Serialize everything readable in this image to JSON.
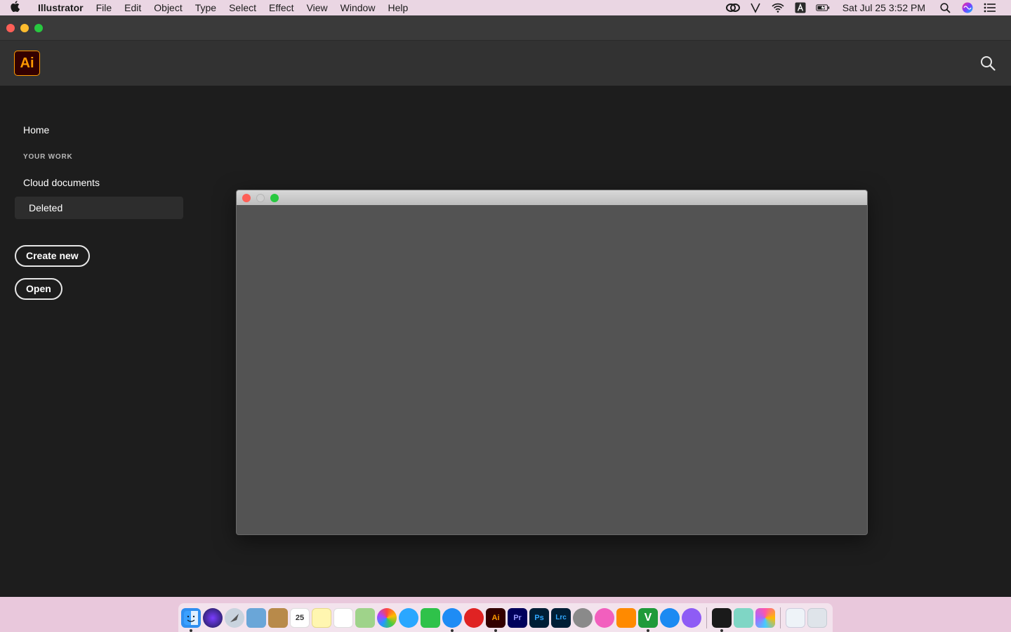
{
  "menubar": {
    "app_name": "Illustrator",
    "items": [
      "File",
      "Edit",
      "Object",
      "Type",
      "Select",
      "Effect",
      "View",
      "Window",
      "Help"
    ],
    "clock": "Sat Jul 25  3:52 PM"
  },
  "header": {
    "logo_text": "Ai"
  },
  "sidebar": {
    "home": "Home",
    "section_label": "YOUR WORK",
    "items": [
      "Cloud documents",
      "Deleted"
    ],
    "active_item": "Deleted"
  },
  "actions": {
    "create_new": "Create new",
    "open": "Open"
  },
  "colors": {
    "ai_orange": "#ff9a00",
    "ai_dark": "#330000",
    "window_bg": "#1d1d1d",
    "dialog_bg": "#535353"
  },
  "dock": {
    "ai_label": "Ai",
    "pr_label": "Pr",
    "ps_label": "Ps",
    "lrc_label": "Lrc",
    "calendar_day": "25",
    "v_label": "V"
  }
}
